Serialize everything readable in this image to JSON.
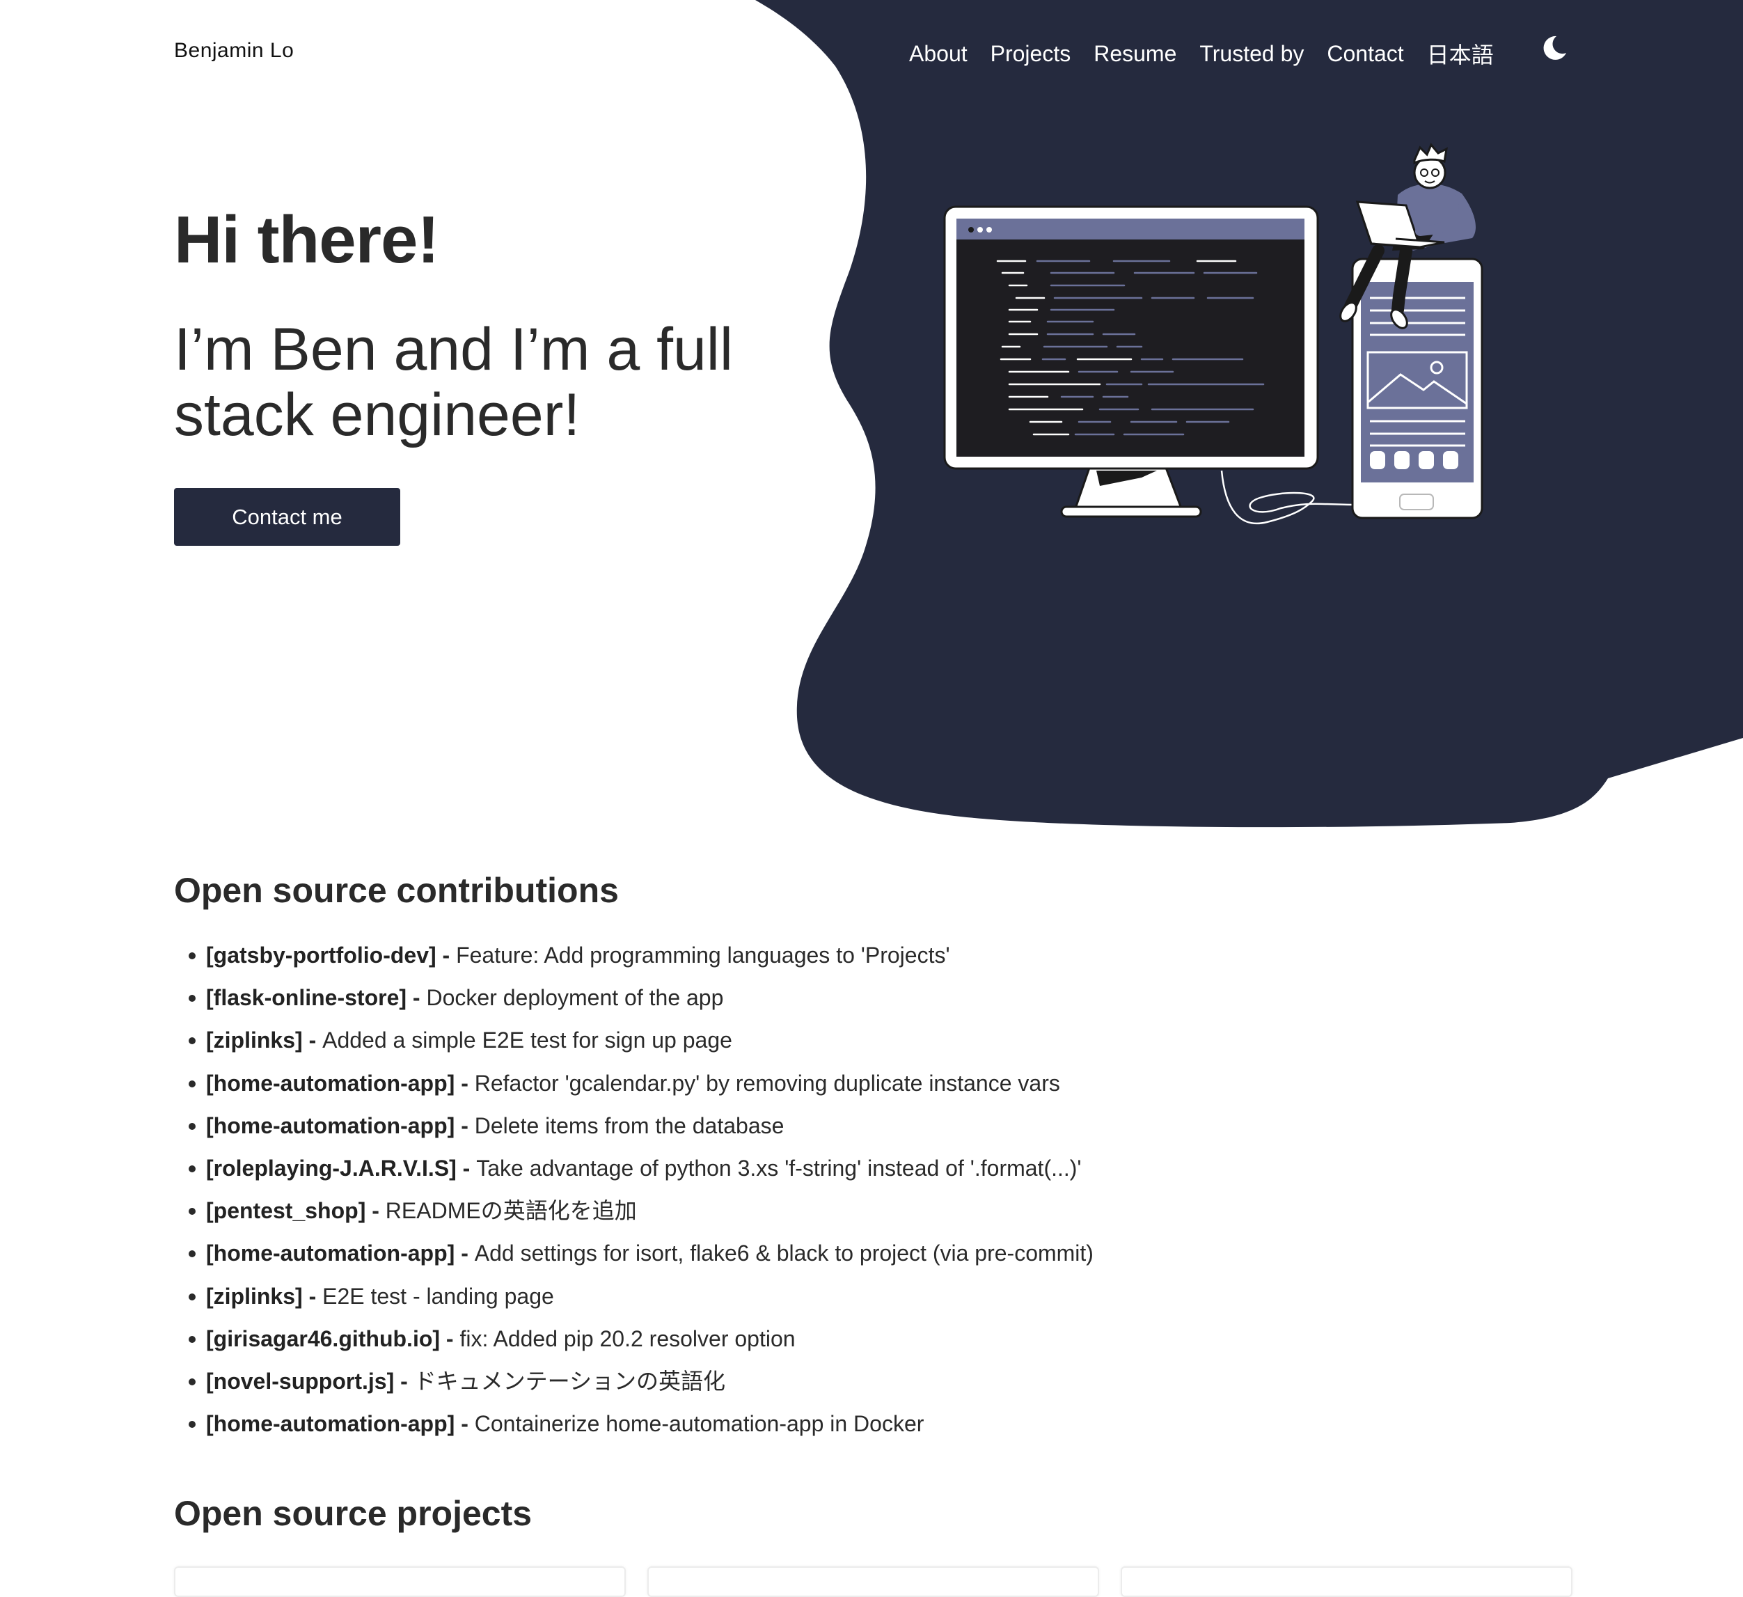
{
  "nav": {
    "brand": "Benjamin Lo",
    "links": [
      "About",
      "Projects",
      "Resume",
      "Trusted by",
      "Contact",
      "日本語"
    ],
    "theme_icon": "moon-icon"
  },
  "hero": {
    "greeting": "Hi there!",
    "tagline": "I’m Ben and I’m a full stack engineer!",
    "cta_label": "Contact me",
    "illustration": "developer-with-monitor-and-phone-illustration"
  },
  "contributions": {
    "title": "Open source contributions",
    "items": [
      {
        "repo": "[gatsby-portfolio-dev]",
        "sep": " - ",
        "desc": "Feature: Add programming languages to 'Projects'"
      },
      {
        "repo": "[flask-online-store]",
        "sep": " - ",
        "desc": "Docker deployment of the app"
      },
      {
        "repo": "[ziplinks]",
        "sep": " - ",
        "desc": "Added a simple E2E test for sign up page"
      },
      {
        "repo": "[home-automation-app]",
        "sep": " - ",
        "desc": "Refactor 'gcalendar.py' by removing duplicate instance vars"
      },
      {
        "repo": "[home-automation-app]",
        "sep": " - ",
        "desc": "Delete items from the database"
      },
      {
        "repo": "[roleplaying-J.A.R.V.I.S]",
        "sep": " - ",
        "desc": "Take advantage of python 3.xs 'f-string' instead of '.format(...)'"
      },
      {
        "repo": "[pentest_shop]",
        "sep": " - ",
        "desc": "READMEの英語化を追加"
      },
      {
        "repo": "[home-automation-app]",
        "sep": " - ",
        "desc": "Add settings for isort, flake6 & black to project (via pre-commit)"
      },
      {
        "repo": "[ziplinks]",
        "sep": " - ",
        "desc": "E2E test - landing page"
      },
      {
        "repo": "[girisagar46.github.io]",
        "sep": " - ",
        "desc": "fix: Added pip 20.2 resolver option"
      },
      {
        "repo": "[novel-support.js]",
        "sep": " - ",
        "desc": "ドキュメンテーションの英語化"
      },
      {
        "repo": "[home-automation-app]",
        "sep": " - ",
        "desc": "Containerize home-automation-app in Docker"
      }
    ]
  },
  "projects": {
    "title": "Open source projects"
  },
  "colors": {
    "navy": "#252a3e",
    "accent": "#6b7199",
    "screen": "#1e1d21",
    "text": "#2a2a2a",
    "background": "#ffffff"
  }
}
